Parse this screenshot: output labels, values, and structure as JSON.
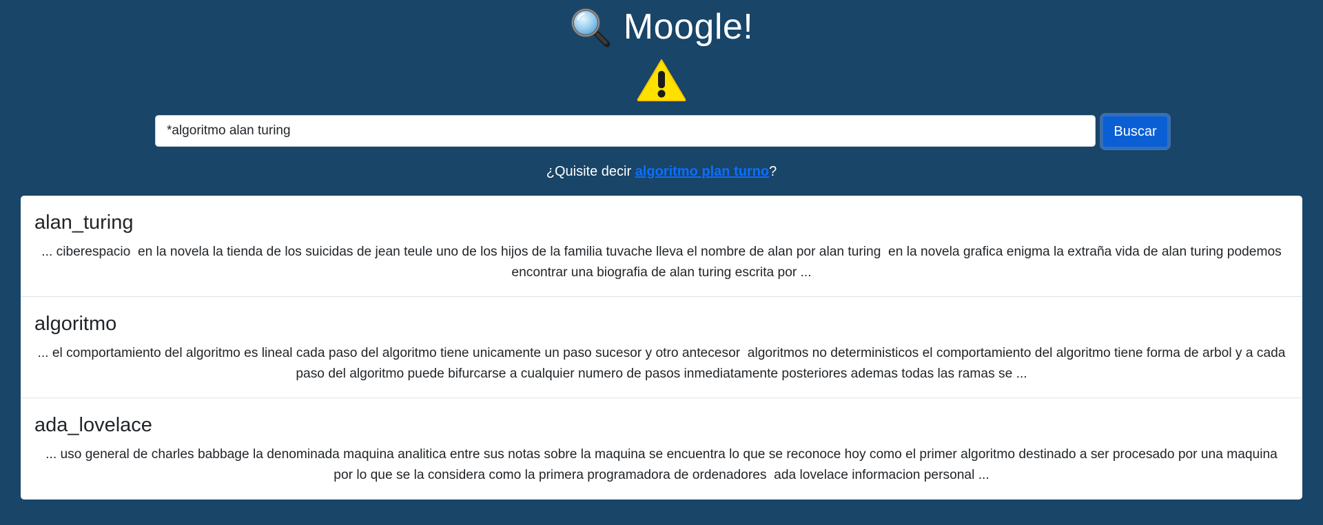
{
  "app": {
    "title": "Moogle!",
    "logo_icon": "magnifying-glass-icon",
    "warning_icon": "warning-icon"
  },
  "search": {
    "value": "*algoritmo alan turing",
    "button_label": "Buscar"
  },
  "suggestion": {
    "prefix": "¿Quisite decir ",
    "query": "algoritmo plan turno",
    "suffix": "?"
  },
  "results": [
    {
      "title": "alan_turing",
      "snippet": "... ciberespacio  en la novela la tienda de los suicidas de jean teule uno de los hijos de la familia tuvache lleva el nombre de alan por alan turing  en la novela grafica enigma la extraña vida de alan turing podemos encontrar una biografia de alan turing escrita por ..."
    },
    {
      "title": "algoritmo",
      "snippet": "... el comportamiento del algoritmo es lineal cada paso del algoritmo tiene unicamente un paso sucesor y otro antecesor  algoritmos no deterministicos el comportamiento del algoritmo tiene forma de arbol y a cada paso del algoritmo puede bifurcarse a cualquier numero de pasos inmediatamente posteriores ademas todas las ramas se ..."
    },
    {
      "title": "ada_lovelace",
      "snippet": "... uso general de charles babbage la denominada maquina analitica entre sus notas sobre la maquina se encuentra lo que se reconoce hoy como el primer algoritmo destinado a ser procesado por una maquina por lo que se la considera como la primera programadora de ordenadores  ada lovelace informacion personal ..."
    }
  ],
  "colors": {
    "background": "#184568",
    "button": "#0b5fd4",
    "link": "#0d6efd",
    "card": "#ffffff",
    "warning": "#ffe100"
  }
}
